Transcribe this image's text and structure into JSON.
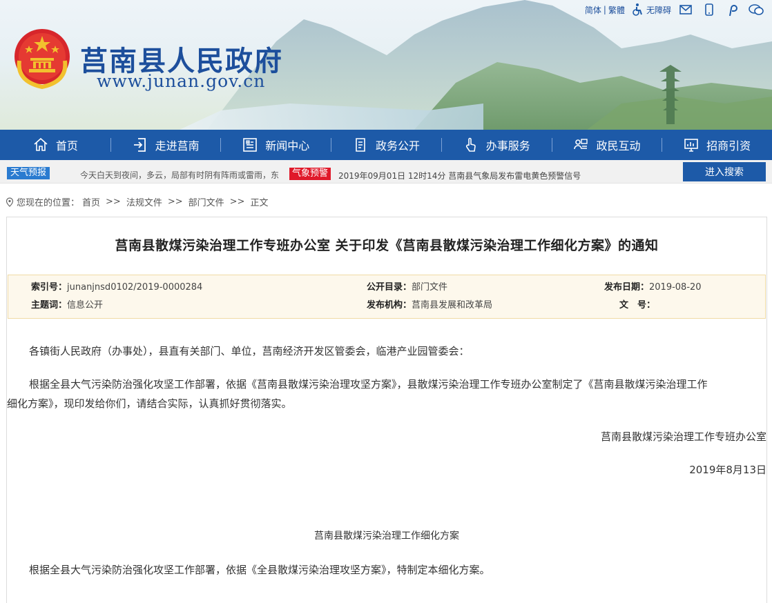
{
  "site": {
    "title": "莒南县人民政府",
    "url": "www.junan.gov.cn"
  },
  "utility": {
    "simplified": "简体",
    "traditional": "繁體",
    "accessibility": "无障碍",
    "icons": [
      "accessibility-icon",
      "mail-icon",
      "mobile-icon",
      "weibo-icon",
      "wechat-icon"
    ]
  },
  "nav": {
    "items": [
      {
        "label": "首页",
        "icon": "home-icon"
      },
      {
        "label": "走进莒南",
        "icon": "enter-icon"
      },
      {
        "label": "新闻中心",
        "icon": "news-icon"
      },
      {
        "label": "政务公开",
        "icon": "document-icon"
      },
      {
        "label": "办事服务",
        "icon": "hand-icon"
      },
      {
        "label": "政民互动",
        "icon": "interaction-icon"
      },
      {
        "label": "招商引资",
        "icon": "investment-icon"
      }
    ]
  },
  "ticker": {
    "weather_label": "天气预报",
    "weather_text": "今天白天到夜间，多云，局部有时阴有阵雨或雷雨，东",
    "warning_label": "气象预警",
    "warning_text": "2019年09月01日 12时14分  莒南县气象局发布雷电黄色预警信号",
    "search_button": "进入搜索"
  },
  "breadcrumb": {
    "prefix": "您现在的位置：",
    "items": [
      "首页",
      "法规文件",
      "部门文件",
      "正文"
    ],
    "separator": ">>"
  },
  "article": {
    "title": "莒南县散煤污染治理工作专班办公室 关于印发《莒南县散煤污染治理工作细化方案》的通知",
    "meta": {
      "index_label": "索引号：",
      "index_value": "junanjnsd0102/2019-0000284",
      "catalog_label": "公开目录：",
      "catalog_value": "部门文件",
      "date_label": "发布日期：",
      "date_value": "2019-08-20",
      "topic_label": "主题词：",
      "topic_value": "信息公开",
      "org_label": "发布机构：",
      "org_value": "莒南县发展和改革局",
      "docno_label": "文　号：",
      "docno_value": ""
    },
    "paragraphs": {
      "p1": "各镇街人民政府（办事处），县直有关部门、单位，莒南经济开发区管委会，临港产业园管委会：",
      "p2a": "根据全县大气污染防治强化攻坚工作部署，依据《莒南县散煤污染治理攻坚方案》，县散煤污染治理工作专班办公室制定了《莒南县散煤污染治理工作",
      "p2b": "细化方案》，现印发给你们，请结合实际，认真抓好贯彻落实。",
      "signature": "莒南县散煤污染治理工作专班办公室",
      "date": "2019年8月13日",
      "subtitle": "莒南县散煤污染治理工作细化方案",
      "p3": "根据全县大气污染防治强化攻坚工作部署，依据《全县散煤污染治理攻坚方案》，特制定本细化方案。"
    }
  },
  "colors": {
    "nav_bg": "#1d5aa8",
    "title_blue": "#1d4f9c",
    "warning_red": "#e0192a",
    "weather_blue": "#2a7bd0",
    "meta_bg": "#fdf8ec"
  }
}
